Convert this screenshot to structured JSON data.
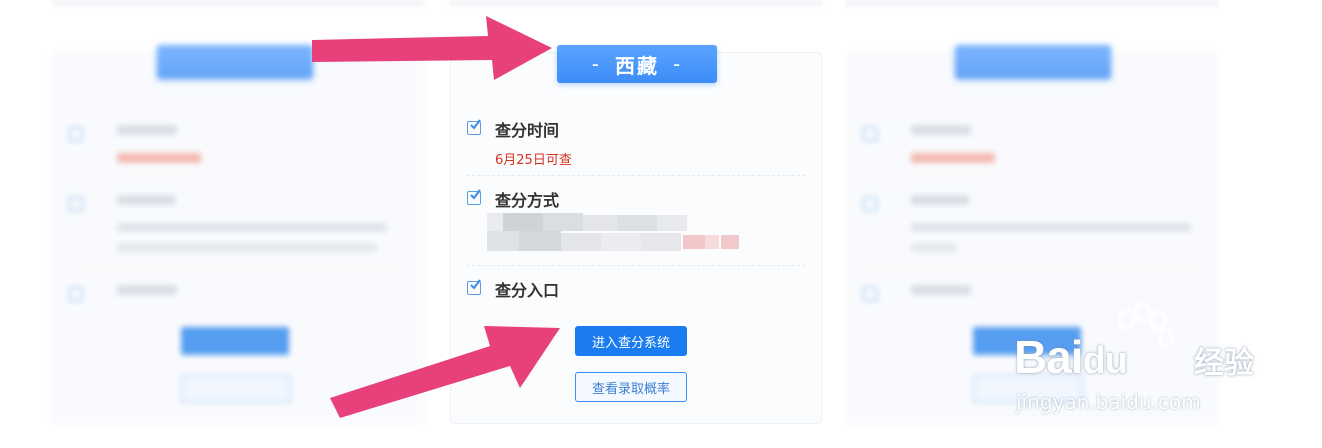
{
  "card": {
    "province": "西藏",
    "dash_left": "-",
    "dash_right": "-",
    "rows": [
      {
        "title": "查分时间",
        "detail": "6月25日可查"
      },
      {
        "title": "查分方式"
      },
      {
        "title": "查分入口"
      }
    ],
    "enter_button": "进入查分系统",
    "view_rate_button": "查看录取概率"
  },
  "watermark": {
    "brand_a": "Bai",
    "brand_b": "du",
    "brand_c": "经验",
    "url": "jingyan.baidu.com"
  },
  "colors": {
    "primary": "#1a7cf0",
    "tag": "#3d8df7",
    "highlight": "#d9321f",
    "arrow": "#e7407a"
  }
}
